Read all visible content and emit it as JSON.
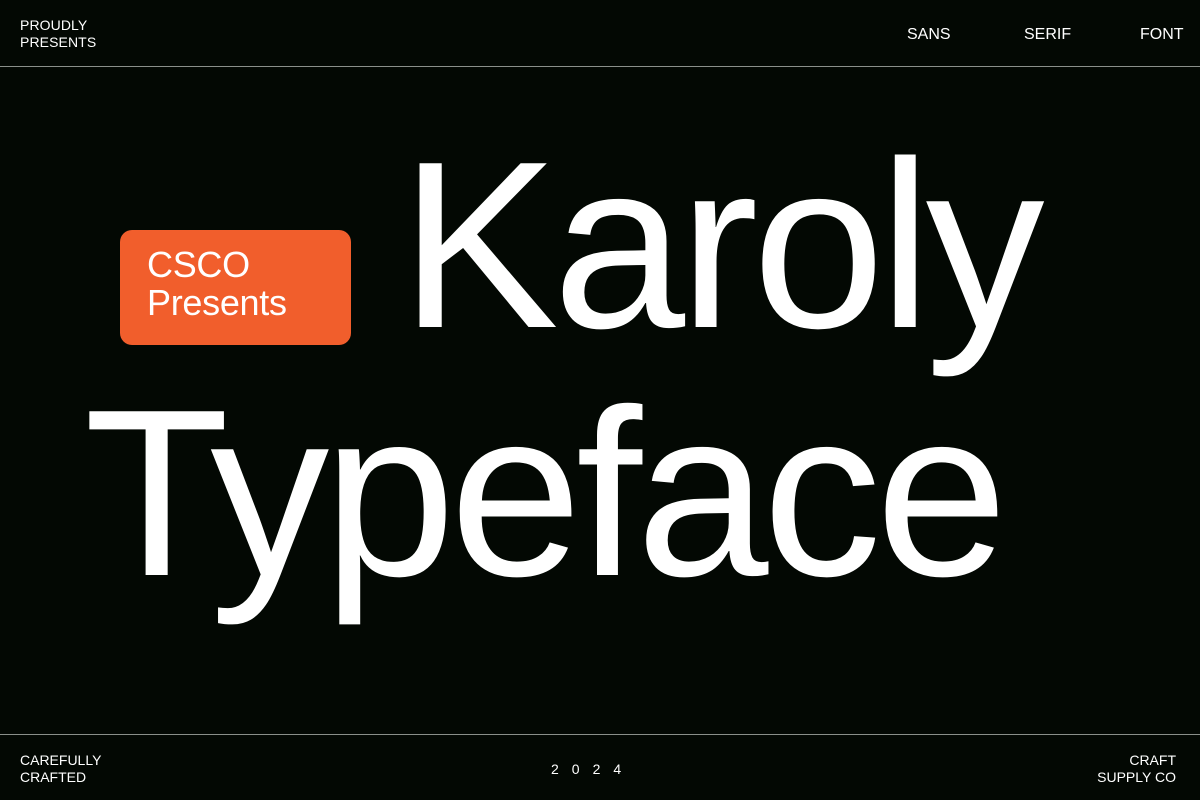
{
  "header": {
    "left_line_1": "PROUDLY",
    "left_line_2": "PRESENTS",
    "nav": [
      "SANS",
      "SERIF",
      "FONT"
    ]
  },
  "badge": {
    "line_1": "CSCO",
    "line_2": "Presents",
    "color": "#F15E2C"
  },
  "headline": {
    "line_1": "Karoly",
    "line_2": "Typeface"
  },
  "footer": {
    "left_line_1": "CAREFULLY",
    "left_line_2": "CRAFTED",
    "center": "2024",
    "right_line_1": "CRAFT",
    "right_line_2": "SUPPLY CO"
  },
  "colors": {
    "background": "#030803",
    "text": "#FFFFFF",
    "divider": "#8A8F8A"
  }
}
